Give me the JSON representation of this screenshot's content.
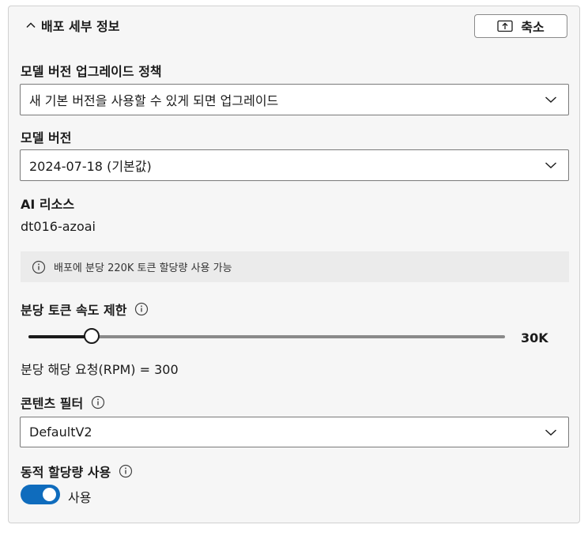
{
  "header": {
    "title": "배포 세부 정보",
    "collapse_label": "축소"
  },
  "upgrade_policy": {
    "label": "모델 버전 업그레이드 정책",
    "selected": "새 기본 버전을 사용할 수 있게 되면 업그레이드"
  },
  "model_version": {
    "label": "모델 버전",
    "selected": "2024-07-18 (기본값)"
  },
  "ai_resource": {
    "label": "AI 리소스",
    "value": "dt016-azoai"
  },
  "info_bar": {
    "text": "배포에 분당 220K 토큰 할당량 사용 가능"
  },
  "rate_limit": {
    "label": "분당 토큰 속도 제한",
    "value_label": "30K",
    "slider_fraction": 0.132,
    "rpm_text": "분당 해당 요청(RPM) = 300"
  },
  "content_filter": {
    "label": "콘텐츠 필터",
    "selected": "DefaultV2"
  },
  "dynamic_quota": {
    "label": "동적 할당량 사용",
    "toggle_label": "사용",
    "enabled": true
  },
  "colors": {
    "accent": "#0f6cbd",
    "panel_bg": "#f6f6f6",
    "info_bg": "#ebebeb"
  }
}
